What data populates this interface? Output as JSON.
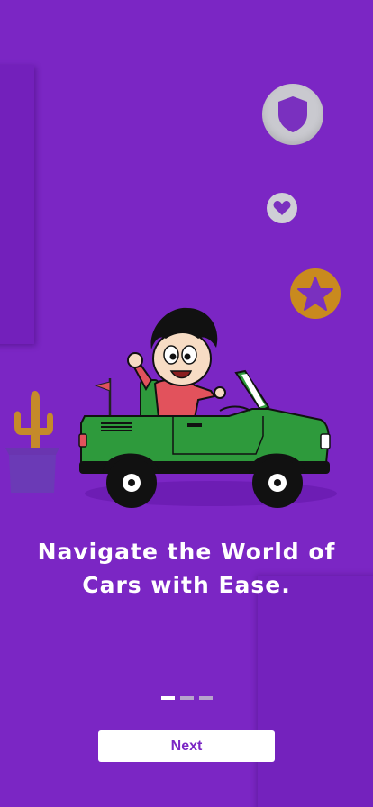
{
  "onboarding": {
    "headline": "Navigate the World of Cars with Ease.",
    "page_indicator": {
      "total": 3,
      "current": 1
    },
    "next_label": "Next"
  },
  "illustration": {
    "badges": [
      "shield-icon",
      "heart-icon",
      "star-icon"
    ],
    "scene": "boy-driving-green-convertible",
    "plant": "cactus-in-pot"
  },
  "colors": {
    "background": "#7b26c4",
    "accent": "#7b26c4",
    "button_bg": "#ffffff",
    "car_body": "#2e9a3c",
    "star_badge": "#c98a1e"
  }
}
